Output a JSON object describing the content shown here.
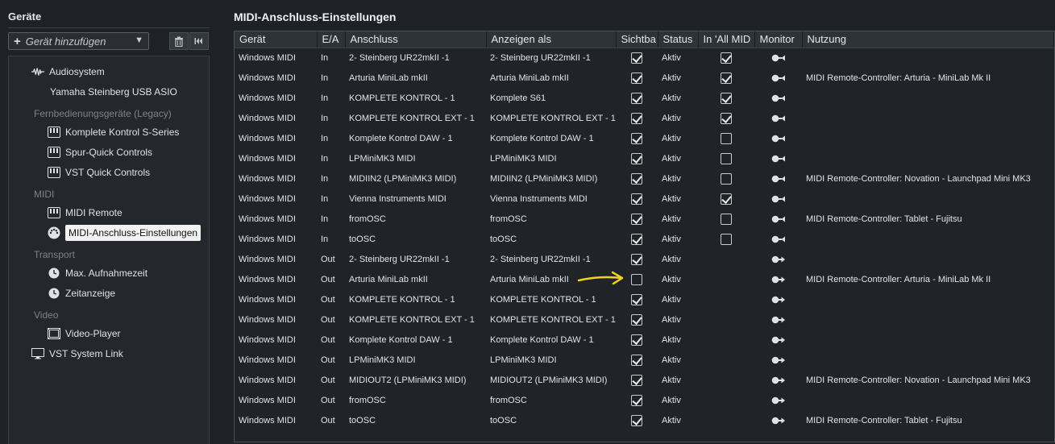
{
  "left": {
    "title": "Geräte",
    "add_device_placeholder": "Gerät hinzufügen",
    "tree": {
      "audio_system": "Audiosystem",
      "audio_driver": "Yamaha Steinberg USB ASIO",
      "cat_remote_legacy": "Fernbedienungsgeräte (Legacy)",
      "komplete_kontrol": "Komplete Kontrol S-Series",
      "spur_quick": "Spur-Quick Controls",
      "vst_quick": "VST Quick Controls",
      "cat_midi": "MIDI",
      "midi_remote": "MIDI Remote",
      "midi_port_settings": "MIDI-Anschluss-Einstellungen",
      "cat_transport": "Transport",
      "max_rec_time": "Max. Aufnahmezeit",
      "time_display": "Zeitanzeige",
      "cat_video": "Video",
      "video_player": "Video-Player",
      "vst_system_link": "VST System Link"
    }
  },
  "main": {
    "title": "MIDI-Anschluss-Einstellungen",
    "columns": [
      "Gerät",
      "E/A",
      "Anschluss",
      "Anzeigen als",
      "Sichtba",
      "Status",
      "In 'All MID",
      "Monitor",
      "Nutzung"
    ],
    "rows": [
      {
        "device": "Windows MIDI",
        "io": "In",
        "port": "2- Steinberg UR22mkII -1",
        "show_as": "2- Steinberg UR22mkII -1",
        "visible": true,
        "status": "Aktiv",
        "all_midi": true,
        "usage": ""
      },
      {
        "device": "Windows MIDI",
        "io": "In",
        "port": "Arturia MiniLab mkII",
        "show_as": "Arturia MiniLab mkII",
        "visible": true,
        "status": "Aktiv",
        "all_midi": true,
        "usage": "MIDI Remote-Controller: Arturia - MiniLab Mk II"
      },
      {
        "device": "Windows MIDI",
        "io": "In",
        "port": "KOMPLETE KONTROL - 1",
        "show_as": "Komplete S61",
        "visible": true,
        "status": "Aktiv",
        "all_midi": true,
        "usage": ""
      },
      {
        "device": "Windows MIDI",
        "io": "In",
        "port": "KOMPLETE KONTROL EXT - 1",
        "show_as": "KOMPLETE KONTROL EXT - 1",
        "visible": true,
        "status": "Aktiv",
        "all_midi": true,
        "usage": ""
      },
      {
        "device": "Windows MIDI",
        "io": "In",
        "port": "Komplete Kontrol DAW - 1",
        "show_as": "Komplete Kontrol DAW - 1",
        "visible": true,
        "status": "Aktiv",
        "all_midi": false,
        "usage": ""
      },
      {
        "device": "Windows MIDI",
        "io": "In",
        "port": "LPMiniMK3 MIDI",
        "show_as": "LPMiniMK3 MIDI",
        "visible": true,
        "status": "Aktiv",
        "all_midi": false,
        "usage": ""
      },
      {
        "device": "Windows MIDI",
        "io": "In",
        "port": "MIDIIN2 (LPMiniMK3 MIDI)",
        "show_as": "MIDIIN2 (LPMiniMK3 MIDI)",
        "visible": true,
        "status": "Aktiv",
        "all_midi": false,
        "usage": "MIDI Remote-Controller: Novation - Launchpad Mini MK3"
      },
      {
        "device": "Windows MIDI",
        "io": "In",
        "port": "Vienna Instruments MIDI",
        "show_as": "Vienna Instruments MIDI",
        "visible": true,
        "status": "Aktiv",
        "all_midi": true,
        "usage": ""
      },
      {
        "device": "Windows MIDI",
        "io": "In",
        "port": "fromOSC",
        "show_as": "fromOSC",
        "visible": true,
        "status": "Aktiv",
        "all_midi": false,
        "usage": "MIDI Remote-Controller: Tablet - Fujitsu"
      },
      {
        "device": "Windows MIDI",
        "io": "In",
        "port": "toOSC",
        "show_as": "toOSC",
        "visible": true,
        "status": "Aktiv",
        "all_midi": false,
        "usage": ""
      },
      {
        "device": "Windows MIDI",
        "io": "Out",
        "port": "2- Steinberg UR22mkII -1",
        "show_as": "2- Steinberg UR22mkII -1",
        "visible": true,
        "status": "Aktiv",
        "all_midi": null,
        "usage": ""
      },
      {
        "device": "Windows MIDI",
        "io": "Out",
        "port": "Arturia MiniLab mkII",
        "show_as": "Arturia MiniLab mkII",
        "visible": false,
        "status": "Aktiv",
        "all_midi": null,
        "usage": "MIDI Remote-Controller: Arturia - MiniLab Mk II"
      },
      {
        "device": "Windows MIDI",
        "io": "Out",
        "port": "KOMPLETE KONTROL - 1",
        "show_as": "KOMPLETE KONTROL - 1",
        "visible": true,
        "status": "Aktiv",
        "all_midi": null,
        "usage": ""
      },
      {
        "device": "Windows MIDI",
        "io": "Out",
        "port": "KOMPLETE KONTROL EXT - 1",
        "show_as": "KOMPLETE KONTROL EXT - 1",
        "visible": true,
        "status": "Aktiv",
        "all_midi": null,
        "usage": ""
      },
      {
        "device": "Windows MIDI",
        "io": "Out",
        "port": "Komplete Kontrol DAW - 1",
        "show_as": "Komplete Kontrol DAW - 1",
        "visible": true,
        "status": "Aktiv",
        "all_midi": null,
        "usage": ""
      },
      {
        "device": "Windows MIDI",
        "io": "Out",
        "port": "LPMiniMK3 MIDI",
        "show_as": "LPMiniMK3 MIDI",
        "visible": true,
        "status": "Aktiv",
        "all_midi": null,
        "usage": ""
      },
      {
        "device": "Windows MIDI",
        "io": "Out",
        "port": "MIDIOUT2 (LPMiniMK3 MIDI)",
        "show_as": "MIDIOUT2 (LPMiniMK3 MIDI)",
        "visible": true,
        "status": "Aktiv",
        "all_midi": null,
        "usage": "MIDI Remote-Controller: Novation - Launchpad Mini MK3"
      },
      {
        "device": "Windows MIDI",
        "io": "Out",
        "port": "fromOSC",
        "show_as": "fromOSC",
        "visible": true,
        "status": "Aktiv",
        "all_midi": null,
        "usage": ""
      },
      {
        "device": "Windows MIDI",
        "io": "Out",
        "port": "toOSC",
        "show_as": "toOSC",
        "visible": true,
        "status": "Aktiv",
        "all_midi": null,
        "usage": "MIDI Remote-Controller: Tablet - Fujitsu"
      }
    ]
  },
  "colors": {
    "background": "#1e2226",
    "annotation_arrow": "#f2d21a",
    "selected_item_bg": "#f2f2f2"
  },
  "icons": [
    "plus-icon",
    "chevron-down-icon",
    "trash-icon",
    "reset-icon",
    "waveform-icon",
    "keyboard-icon",
    "midi-port-icon",
    "clock-icon",
    "film-icon",
    "monitor-icon",
    "monitor-in-icon",
    "monitor-out-icon",
    "arrow-annotation-icon"
  ]
}
